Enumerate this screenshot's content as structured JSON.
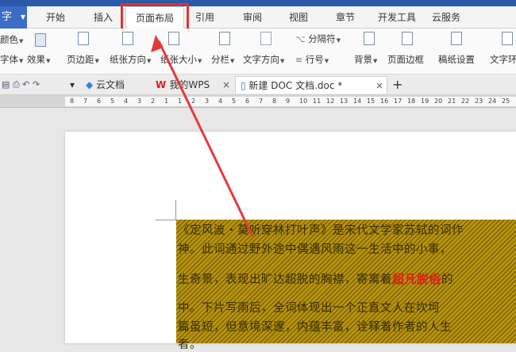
{
  "app": {
    "logo_label": "字",
    "logo_caret": "▼"
  },
  "menu": {
    "tabs": [
      {
        "label": "开始"
      },
      {
        "label": "插入"
      },
      {
        "label": "页面布局"
      },
      {
        "label": "引用"
      },
      {
        "label": "审阅"
      },
      {
        "label": "视图"
      },
      {
        "label": "章节"
      },
      {
        "label": "开发工具"
      },
      {
        "label": "云服务"
      }
    ],
    "active": "页面布局"
  },
  "toolbar": {
    "theme_colors": "颜色",
    "theme_fonts": "字体",
    "theme_effects": "效果",
    "margins": "页边距",
    "orientation": "纸张方向",
    "size": "纸张大小",
    "columns": "分栏",
    "text_direction": "文字方向",
    "separator": "分隔符",
    "line_numbers": "行号",
    "background": "背景",
    "page_border": "页面边框",
    "paper_settings": "稿纸设置",
    "text_wrap": "文字环"
  },
  "doc_tabs": {
    "cloud": "云文档",
    "wps": "我的WPS",
    "doc": "新建 DOC 文档.doc *",
    "add": "+",
    "close": "×"
  },
  "ruler": {
    "labels": [
      "8",
      "7",
      "6",
      "5",
      "4",
      "3",
      "2",
      "1",
      "1",
      "2",
      "3",
      "4",
      "5",
      "6",
      "7",
      "8",
      "9",
      "10",
      "11",
      "12",
      "13",
      "14",
      "15",
      "16",
      "17",
      "18",
      "19",
      "20",
      "21",
      "22",
      "23",
      "24",
      "25"
    ]
  },
  "document": {
    "line1": "《定风波・莫听穿林打叶声》是宋代文学家苏轼的词作",
    "line2": "神。此词通过野外途中偶遇风雨这一生活中的小事，",
    "line3a": "生奇景，表现出旷达超脱的胸襟，寄寓着",
    "line3b": "超凡脱俗",
    "line3c": "的",
    "line4": "中。下片写雨后，全词体现出一个正直文人在坎坷",
    "line5": "篇虽短，但意境深邃，内蕴丰富，诠释着作者的人生",
    "line6": "者。"
  },
  "colors": {
    "accent": "#3b6cc7",
    "highlight_box": "#e53030",
    "text_highlight": "#b8940e",
    "emphasis": "#e21a1a"
  }
}
